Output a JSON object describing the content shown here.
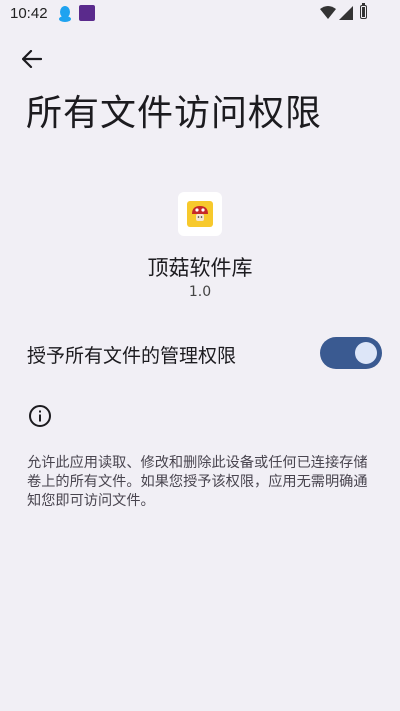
{
  "status_bar": {
    "time": "10:42"
  },
  "page": {
    "title": "所有文件访问权限"
  },
  "app": {
    "name": "顶菇软件库",
    "version": "1.0"
  },
  "permission": {
    "label": "授予所有文件的管理权限",
    "enabled": true
  },
  "info": {
    "description": "允许此应用读取、修改和删除此设备或任何已连接存储卷上的所有文件。如果您授予该权限，应用无需明确通知您即可访问文件。"
  },
  "colors": {
    "background": "#f1eff5",
    "toggle_track": "#3a5a91",
    "toggle_thumb": "#dde6f8",
    "app_icon_bg": "#f7c92c"
  }
}
